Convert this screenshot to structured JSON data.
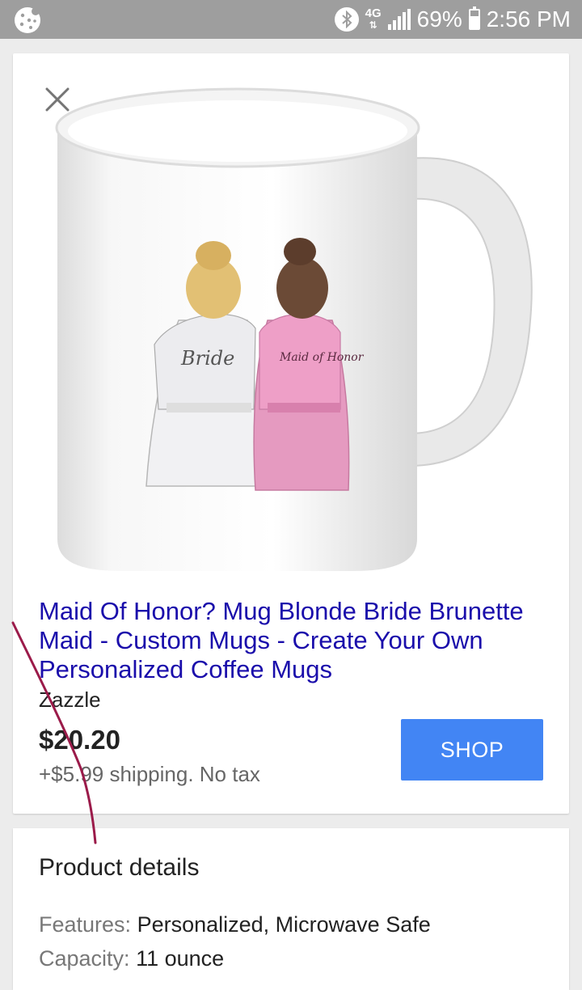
{
  "status_bar": {
    "network": "4G",
    "battery": "69%",
    "battery_level": 0.69,
    "time": "2:56 PM",
    "icons": [
      "cookie-app-icon",
      "bluetooth-icon",
      "network-4g-icon",
      "signal-icon",
      "battery-icon"
    ]
  },
  "product": {
    "image_icon": "mug-product-image",
    "title": "Maid Of Honor? Mug Blonde Bride Brunette Maid - Custom Mugs - Create Your Own Personalized Coffee Mugs",
    "seller": "Zazzle",
    "price": "$20.20",
    "shipping": "+$5.99 shipping. No tax",
    "shop_label": "SHOP",
    "close_icon": "close-icon",
    "mug_text_left": "Bride",
    "mug_text_right": "Maid of Honor"
  },
  "details": {
    "heading": "Product details",
    "rows": [
      {
        "label": "Features:",
        "value": "Personalized, Microwave Safe"
      },
      {
        "label": "Capacity:",
        "value": "11 ounce"
      }
    ]
  },
  "colors": {
    "accent": "#4285f4",
    "title_link": "#1a0dab",
    "status_bar": "#9e9e9e",
    "annotation_stroke": "#9b1b4a"
  }
}
